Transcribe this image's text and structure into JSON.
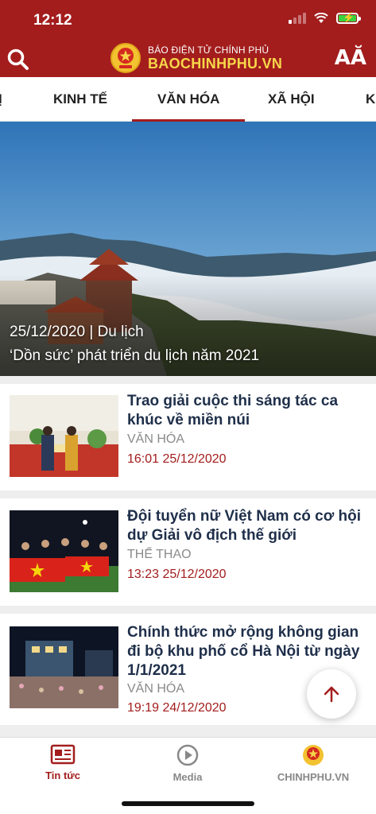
{
  "status_bar": {
    "time": "12:12"
  },
  "header": {
    "brand_top": "BÁO ĐIỆN TỬ CHÍNH PHỦ",
    "brand_main": "BAOCHINHPHU.VN",
    "font_size_label": "AĂ",
    "search_icon": "search-icon"
  },
  "tabs": [
    {
      "label": "Ị"
    },
    {
      "label": "KINH TẾ"
    },
    {
      "label": "VĂN HÓA",
      "active": true
    },
    {
      "label": "XÃ HỘI"
    },
    {
      "label": "K"
    }
  ],
  "hero": {
    "meta": "25/12/2020 | Du lịch",
    "title": "‘Dồn sức’ phát triển du lịch năm 2021"
  },
  "articles": [
    {
      "title": "Trao giải cuộc thi sáng tác ca khúc về miền núi",
      "category": "VĂN HÓA",
      "time": "16:01 25/12/2020"
    },
    {
      "title": "Đội tuyển nữ Việt Nam có cơ hội dự Giải vô địch thế giới",
      "category": "THỂ THAO",
      "time": "13:23 25/12/2020"
    },
    {
      "title": "Chính thức mở rộng không gian đi bộ khu phố cổ Hà Nội từ ngày 1/1/2021",
      "category": "VĂN HÓA",
      "time": "19:19 24/12/2020"
    }
  ],
  "bottom_nav": [
    {
      "label": "Tin tức",
      "icon": "newspaper-icon",
      "active": true
    },
    {
      "label": "Media",
      "icon": "play-icon"
    },
    {
      "label": "CHINHPHU.VN",
      "icon": "emblem-icon"
    }
  ],
  "colors": {
    "brand_red": "#a31d1d",
    "brand_gold": "#f7d74a",
    "title_navy": "#1f2f4a"
  }
}
